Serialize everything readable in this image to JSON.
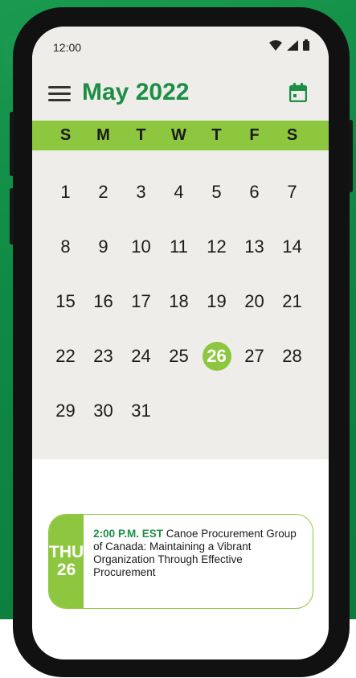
{
  "status_bar": {
    "time": "12:00"
  },
  "header": {
    "month_title": "May 2022"
  },
  "weekdays": [
    "S",
    "M",
    "T",
    "W",
    "T",
    "F",
    "S"
  ],
  "weeks": [
    [
      "1",
      "2",
      "3",
      "4",
      "5",
      "6",
      "7"
    ],
    [
      "8",
      "9",
      "10",
      "11",
      "12",
      "13",
      "14"
    ],
    [
      "15",
      "16",
      "17",
      "18",
      "19",
      "20",
      "21"
    ],
    [
      "22",
      "23",
      "24",
      "25",
      "26",
      "27",
      "28"
    ],
    [
      "29",
      "30",
      "31"
    ]
  ],
  "selected_day": "26",
  "event": {
    "day_of_week": "THU",
    "day_number": "26",
    "time": "2:00 P.M. EST",
    "title": "Canoe Procurement Group of Canada: Maintaining a Vibrant Organization Through Effective Procurement"
  },
  "colors": {
    "brand_green": "#1c8f45",
    "accent_lime": "#8dc63f",
    "calendar_bg": "#efedea"
  },
  "icons": [
    "menu-icon",
    "calendar-icon",
    "wifi-icon",
    "signal-icon",
    "battery-icon"
  ]
}
